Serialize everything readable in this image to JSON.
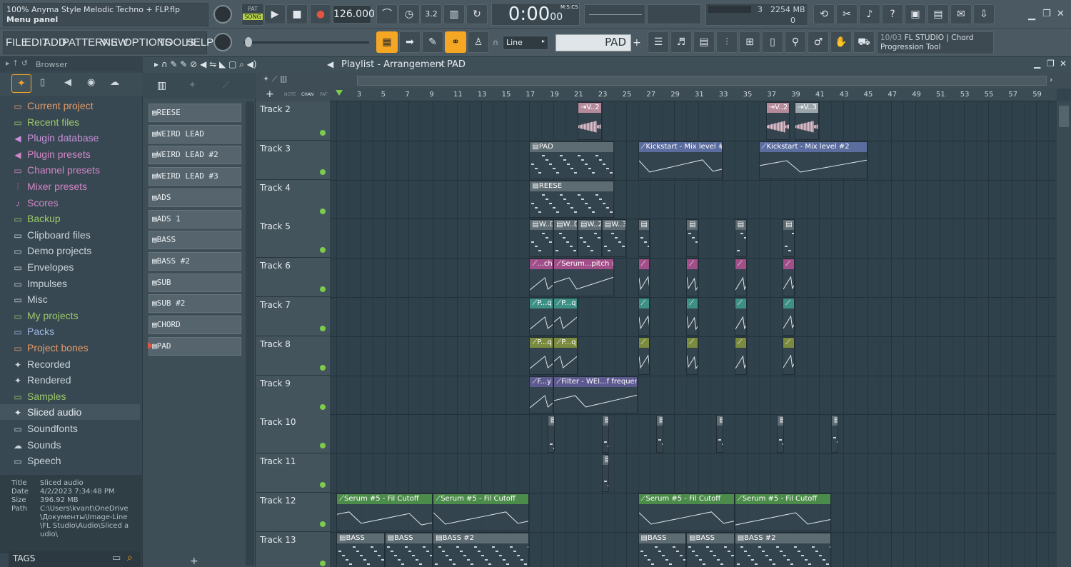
{
  "window": {
    "title": "100% Anyma Style Melodic Techno + FLP.flp",
    "hint": "Menu panel"
  },
  "transport": {
    "pat_label": "PAT",
    "song_label": "SONG",
    "tempo": "126.000",
    "time": "0:00",
    "time_sub": "00",
    "time_mode": "M:S:CS"
  },
  "monitor": {
    "cpu": "3",
    "memory": "2254 MB",
    "polyphony": "0"
  },
  "menu": [
    "FILE",
    "EDIT",
    "ADD",
    "PATTERNS",
    "VIEW",
    "OPTIONS",
    "TOOLS",
    "HELP"
  ],
  "snap": {
    "value": "Line"
  },
  "pattern_selector": {
    "value": "PAD",
    "add": "+"
  },
  "news": {
    "date": "10/03",
    "text": "FL STUDIO | Chord Progression Tool"
  },
  "browser": {
    "title": "Browser",
    "items": [
      "Current project",
      "Recent files",
      "Plugin database",
      "Plugin presets",
      "Channel presets",
      "Mixer presets",
      "Scores",
      "Backup",
      "Clipboard files",
      "Demo projects",
      "Envelopes",
      "Impulses",
      "Misc",
      "My projects",
      "Packs",
      "Project bones",
      "Recorded",
      "Rendered",
      "Samples",
      "Sliced audio",
      "Soundfonts",
      "Sounds",
      "Speech"
    ],
    "info": {
      "title_label": "Title",
      "title": "Sliced audio",
      "date_label": "Date",
      "date": "4/2/2023 7:34:48 PM",
      "size_label": "Size",
      "size": "396.92 MB",
      "path_label": "Path",
      "path": "C:\\Users\\kvant\\OneDrive\\Документы\\Image-Line\\FL Studio\\Audio\\Sliced audio\\"
    },
    "tags": "TAGS"
  },
  "picker": {
    "tabs": [
      "NOTE",
      "CHAN",
      "PAT"
    ],
    "patterns": [
      "REESE",
      "WEIRD LEAD",
      "WEIRD LEAD #2",
      "WEIRD LEAD #3",
      "ADS",
      "ADS 1",
      "BASS",
      "BASS #2",
      "SUB",
      "SUB #2",
      "CHORD",
      "PAD"
    ]
  },
  "playlist": {
    "title": "Playlist - Arrangement",
    "crumb": "PAD",
    "tracks": [
      "Track 2",
      "Track 3",
      "Track 4",
      "Track 5",
      "Track 6",
      "Track 7",
      "Track 8",
      "Track 9",
      "Track 10",
      "Track 11",
      "Track 12",
      "Track 13"
    ],
    "bars": [
      "3",
      "5",
      "7",
      "9",
      "11",
      "13",
      "15",
      "17",
      "19",
      "21",
      "23",
      "25",
      "27",
      "29",
      "31",
      "33",
      "35",
      "37",
      "39",
      "41",
      "43",
      "45",
      "47",
      "49",
      "51",
      "53",
      "55",
      "57",
      "59"
    ],
    "clips": [
      {
        "track": 0,
        "bar": 21,
        "len": 2,
        "label": "V..2",
        "color": "#b58a9a",
        "kind": "audio"
      },
      {
        "track": 0,
        "bar": 36.6,
        "len": 2,
        "label": "V..2",
        "color": "#b58a9a",
        "kind": "audio"
      },
      {
        "track": 0,
        "bar": 39,
        "len": 2,
        "label": "V..3",
        "color": "#9aa6ab",
        "kind": "audio"
      },
      {
        "track": 1,
        "bar": 17,
        "len": 7,
        "label": "PAD",
        "color": "#5d6b72",
        "kind": "notes"
      },
      {
        "track": 1,
        "bar": 26,
        "len": 7,
        "label": "Kickstart - Mix level #2",
        "color": "#5b6c9e",
        "kind": "auto"
      },
      {
        "track": 1,
        "bar": 36,
        "len": 9,
        "label": "Kickstart - Mix level #2",
        "color": "#5b6c9e",
        "kind": "auto"
      },
      {
        "track": 2,
        "bar": 17,
        "len": 7,
        "label": "REESE",
        "color": "#5d6b72",
        "kind": "notes"
      },
      {
        "track": 3,
        "bar": 17,
        "len": 2,
        "label": "W..D",
        "color": "#5d6b72",
        "kind": "notes"
      },
      {
        "track": 3,
        "bar": 19,
        "len": 2,
        "label": "W..D",
        "color": "#5d6b72",
        "kind": "notes"
      },
      {
        "track": 3,
        "bar": 21,
        "len": 2,
        "label": "W..2",
        "color": "#5d6b72",
        "kind": "notes"
      },
      {
        "track": 3,
        "bar": 23,
        "len": 2,
        "label": "W..3",
        "color": "#5d6b72",
        "kind": "notes"
      },
      {
        "track": 3,
        "bar": 26,
        "len": 1,
        "label": "",
        "color": "#5d6b72",
        "kind": "notes"
      },
      {
        "track": 3,
        "bar": 30,
        "len": 1,
        "label": "",
        "color": "#5d6b72",
        "kind": "notes"
      },
      {
        "track": 3,
        "bar": 34,
        "len": 1,
        "label": "",
        "color": "#5d6b72",
        "kind": "notes"
      },
      {
        "track": 3,
        "bar": 38,
        "len": 1,
        "label": "",
        "color": "#5d6b72",
        "kind": "notes"
      },
      {
        "track": 4,
        "bar": 17,
        "len": 2,
        "label": "...ch",
        "color": "#a04f88",
        "kind": "auto"
      },
      {
        "track": 4,
        "bar": 19,
        "len": 5,
        "label": "Serum...pitch #3",
        "color": "#a04f88",
        "kind": "auto"
      },
      {
        "track": 4,
        "bar": 26,
        "len": 1,
        "label": "",
        "color": "#a04f88",
        "kind": "auto"
      },
      {
        "track": 4,
        "bar": 30,
        "len": 1,
        "label": "",
        "color": "#a04f88",
        "kind": "auto"
      },
      {
        "track": 4,
        "bar": 34,
        "len": 1,
        "label": "",
        "color": "#a04f88",
        "kind": "auto"
      },
      {
        "track": 4,
        "bar": 38,
        "len": 1,
        "label": "",
        "color": "#a04f88",
        "kind": "auto"
      },
      {
        "track": 5,
        "bar": 17,
        "len": 2,
        "label": "P...q",
        "color": "#3e8f85",
        "kind": "auto"
      },
      {
        "track": 5,
        "bar": 19,
        "len": 2,
        "label": "P...q",
        "color": "#3e8f85",
        "kind": "auto"
      },
      {
        "track": 5,
        "bar": 26,
        "len": 1,
        "label": "",
        "color": "#3e8f85",
        "kind": "auto"
      },
      {
        "track": 5,
        "bar": 30,
        "len": 1,
        "label": "",
        "color": "#3e8f85",
        "kind": "auto"
      },
      {
        "track": 5,
        "bar": 34,
        "len": 1,
        "label": "",
        "color": "#3e8f85",
        "kind": "auto"
      },
      {
        "track": 5,
        "bar": 38,
        "len": 1,
        "label": "",
        "color": "#3e8f85",
        "kind": "auto"
      },
      {
        "track": 6,
        "bar": 17,
        "len": 2,
        "label": "P...q",
        "color": "#7a8a3e",
        "kind": "auto"
      },
      {
        "track": 6,
        "bar": 19,
        "len": 2,
        "label": "P...q",
        "color": "#7a8a3e",
        "kind": "auto"
      },
      {
        "track": 6,
        "bar": 26,
        "len": 1,
        "label": "",
        "color": "#7a8a3e",
        "kind": "auto"
      },
      {
        "track": 6,
        "bar": 30,
        "len": 1,
        "label": "",
        "color": "#7a8a3e",
        "kind": "auto"
      },
      {
        "track": 6,
        "bar": 34,
        "len": 1,
        "label": "",
        "color": "#7a8a3e",
        "kind": "auto"
      },
      {
        "track": 6,
        "bar": 38,
        "len": 1,
        "label": "",
        "color": "#7a8a3e",
        "kind": "auto"
      },
      {
        "track": 7,
        "bar": 17,
        "len": 2,
        "label": "F...y",
        "color": "#5c5a8e",
        "kind": "auto"
      },
      {
        "track": 7,
        "bar": 19,
        "len": 7,
        "label": "Filter - WEI...f frequency",
        "color": "#5c5a8e",
        "kind": "auto"
      },
      {
        "track": 8,
        "bar": 18.5,
        "len": 0.6,
        "label": "",
        "color": "#5d6b72",
        "kind": "notes"
      },
      {
        "track": 8,
        "bar": 23,
        "len": 0.6,
        "label": "",
        "color": "#5d6b72",
        "kind": "notes"
      },
      {
        "track": 8,
        "bar": 27.5,
        "len": 0.6,
        "label": "",
        "color": "#5d6b72",
        "kind": "notes"
      },
      {
        "track": 8,
        "bar": 32.5,
        "len": 0.6,
        "label": "",
        "color": "#5d6b72",
        "kind": "notes"
      },
      {
        "track": 8,
        "bar": 37.5,
        "len": 0.6,
        "label": "",
        "color": "#5d6b72",
        "kind": "notes"
      },
      {
        "track": 8,
        "bar": 42,
        "len": 0.6,
        "label": "",
        "color": "#5d6b72",
        "kind": "notes"
      },
      {
        "track": 9,
        "bar": 23,
        "len": 0.6,
        "label": "",
        "color": "#5d6b72",
        "kind": "notes"
      },
      {
        "track": 10,
        "bar": 1,
        "len": 8,
        "label": "Serum #5 - Fil Cutoff",
        "color": "#4c8c4a",
        "kind": "auto"
      },
      {
        "track": 10,
        "bar": 9,
        "len": 8,
        "label": "Serum #5 - Fil Cutoff",
        "color": "#4c8c4a",
        "kind": "auto"
      },
      {
        "track": 10,
        "bar": 26,
        "len": 8,
        "label": "Serum #5 - Fil Cutoff",
        "color": "#4c8c4a",
        "kind": "auto"
      },
      {
        "track": 10,
        "bar": 34,
        "len": 8,
        "label": "Serum #5 - Fil Cutoff",
        "color": "#4c8c4a",
        "kind": "auto"
      },
      {
        "track": 11,
        "bar": 1,
        "len": 4,
        "label": "BASS",
        "color": "#5d6b72",
        "kind": "notes"
      },
      {
        "track": 11,
        "bar": 5,
        "len": 4,
        "label": "BASS",
        "color": "#5d6b72",
        "kind": "notes"
      },
      {
        "track": 11,
        "bar": 9,
        "len": 8,
        "label": "BASS #2",
        "color": "#5d6b72",
        "kind": "notes"
      },
      {
        "track": 11,
        "bar": 26,
        "len": 4,
        "label": "BASS",
        "color": "#5d6b72",
        "kind": "notes"
      },
      {
        "track": 11,
        "bar": 30,
        "len": 4,
        "label": "BASS",
        "color": "#5d6b72",
        "kind": "notes"
      },
      {
        "track": 11,
        "bar": 34,
        "len": 8,
        "label": "BASS #2",
        "color": "#5d6b72",
        "kind": "notes"
      }
    ]
  }
}
